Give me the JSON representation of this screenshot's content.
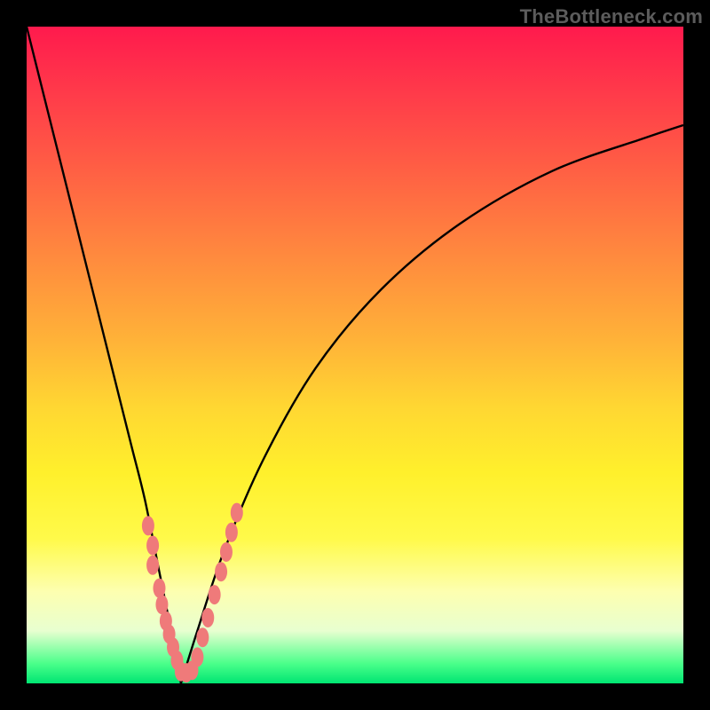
{
  "watermark": "TheBottleneck.com",
  "chart_data": {
    "type": "line",
    "title": "",
    "xlabel": "",
    "ylabel": "",
    "xlim": [
      0,
      100
    ],
    "ylim": [
      0,
      100
    ],
    "grid": false,
    "legend": false,
    "description": "Rainbow vertical gradient background (red top → green bottom) with a black V-shaped curve whose minimum sits near the bottom-left region. Pink bead-like markers cluster along the lower portions of both arms of the V.",
    "series": [
      {
        "name": "left-arm",
        "x": [
          0,
          2,
          4,
          6,
          8,
          10,
          12,
          14,
          16,
          18,
          20,
          22,
          23.5
        ],
        "y": [
          100,
          92,
          84,
          76,
          68,
          60,
          52,
          44,
          36,
          28,
          18,
          8,
          0
        ]
      },
      {
        "name": "right-arm",
        "x": [
          23.5,
          26,
          30,
          36,
          44,
          54,
          66,
          80,
          94,
          100
        ],
        "y": [
          0,
          8,
          20,
          34,
          48,
          60,
          70,
          78,
          83,
          85
        ]
      }
    ],
    "markers": {
      "color": "#ef7a7a",
      "points": [
        {
          "x": 18.5,
          "y": 24
        },
        {
          "x": 19.2,
          "y": 21
        },
        {
          "x": 19.2,
          "y": 18
        },
        {
          "x": 20.2,
          "y": 14.5
        },
        {
          "x": 20.6,
          "y": 12
        },
        {
          "x": 21.2,
          "y": 9.5
        },
        {
          "x": 21.7,
          "y": 7.5
        },
        {
          "x": 22.3,
          "y": 5.5
        },
        {
          "x": 22.9,
          "y": 3.5
        },
        {
          "x": 23.5,
          "y": 1.8
        },
        {
          "x": 24.3,
          "y": 1.6
        },
        {
          "x": 25.2,
          "y": 2.0
        },
        {
          "x": 26.0,
          "y": 4.0
        },
        {
          "x": 26.8,
          "y": 7.0
        },
        {
          "x": 27.6,
          "y": 10.0
        },
        {
          "x": 28.6,
          "y": 13.5
        },
        {
          "x": 29.6,
          "y": 17.0
        },
        {
          "x": 30.4,
          "y": 20.0
        },
        {
          "x": 31.2,
          "y": 23.0
        },
        {
          "x": 32.0,
          "y": 26.0
        }
      ]
    }
  }
}
